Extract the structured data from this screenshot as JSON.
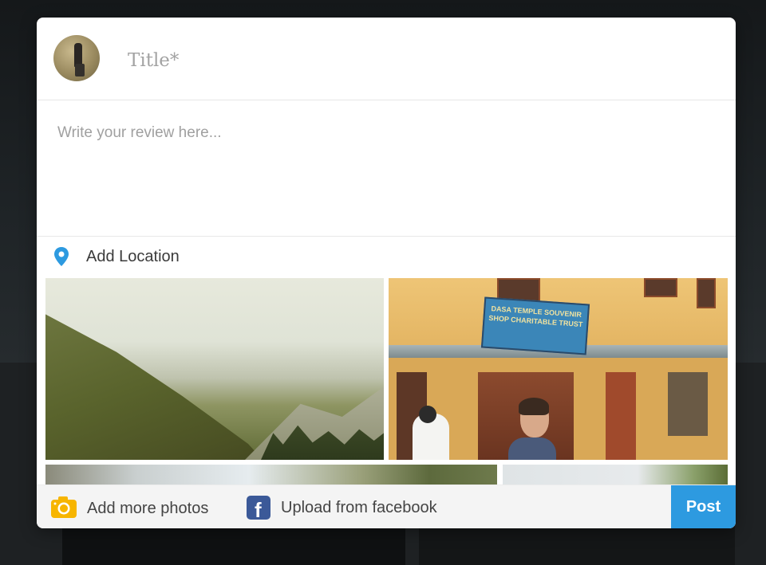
{
  "colors": {
    "accent": "#2d9ae0",
    "facebook": "#3b5998",
    "camera": "#f7b500",
    "pin": "#2d9ae0"
  },
  "post_form": {
    "title_placeholder": "Title*",
    "title_value": "",
    "review_placeholder": "Write your review here...",
    "review_value": "",
    "location": {
      "icon": "map-pin-icon",
      "label": "Add Location"
    },
    "photos": {
      "count": 4,
      "items": [
        {
          "depicts": "mountain-valley"
        },
        {
          "depicts": "temple-souvenir-shop"
        },
        {
          "depicts": "hillside-partial"
        },
        {
          "depicts": "trees-partial"
        }
      ],
      "sign_text": "DASA TEMPLE SOUVENIR SHOP CHARITABLE TRUST"
    }
  },
  "footer": {
    "add_photos": {
      "icon": "camera-icon",
      "label": "Add more photos"
    },
    "facebook": {
      "icon": "facebook-icon",
      "label": "Upload from facebook"
    },
    "post_label": "Post"
  }
}
